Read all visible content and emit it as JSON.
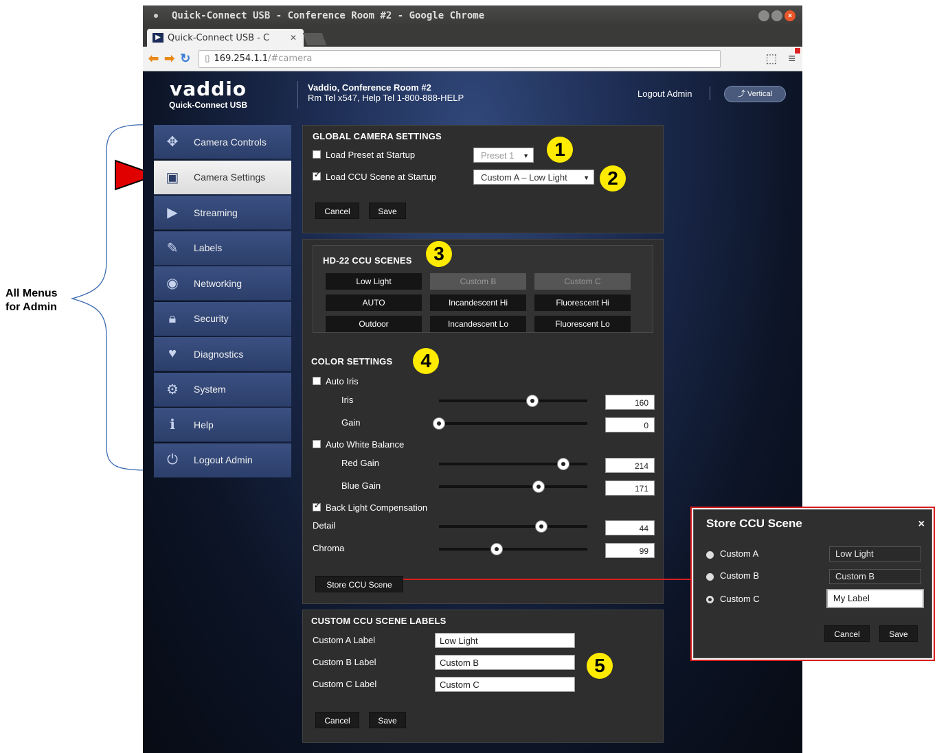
{
  "annotation": {
    "all_menus_line1": "All Menus",
    "all_menus_line2": "for Admin"
  },
  "browser": {
    "window_title": "Quick-Connect USB - Conference Room #2 - Google Chrome",
    "tab_title": "Quick-Connect USB - C",
    "url_host": "169.254.1.1",
    "url_path": "/#camera"
  },
  "header": {
    "brand": "vaddio",
    "product": "Quick-Connect USB",
    "room_title": "Vaddio, Conference Room #2",
    "room_info": "Rm Tel x547, Help Tel 1-800-888-HELP",
    "logout": "Logout Admin",
    "vertical": "Vertical"
  },
  "sidebar": {
    "items": [
      {
        "label": "Camera Controls",
        "icon": "camera-controls-icon",
        "active": false
      },
      {
        "label": "Camera Settings",
        "icon": "camera-settings-icon",
        "active": true
      },
      {
        "label": "Streaming",
        "icon": "streaming-icon",
        "active": false
      },
      {
        "label": "Labels",
        "icon": "labels-icon",
        "active": false
      },
      {
        "label": "Networking",
        "icon": "networking-icon",
        "active": false
      },
      {
        "label": "Security",
        "icon": "security-icon",
        "active": false
      },
      {
        "label": "Diagnostics",
        "icon": "diagnostics-icon",
        "active": false
      },
      {
        "label": "System",
        "icon": "system-icon",
        "active": false
      },
      {
        "label": "Help",
        "icon": "help-icon",
        "active": false
      },
      {
        "label": "Logout Admin",
        "icon": "power-icon",
        "active": false
      }
    ]
  },
  "global": {
    "title": "GLOBAL CAMERA SETTINGS",
    "load_preset_label": "Load Preset at Startup",
    "load_preset_checked": false,
    "preset_value": "Preset 1",
    "load_ccu_label": "Load CCU Scene at Startup",
    "load_ccu_checked": true,
    "ccu_value": "Custom A – Low Light",
    "cancel": "Cancel",
    "save": "Save"
  },
  "scenes": {
    "title": "HD-22 CCU SCENES",
    "buttons": [
      [
        "Low Light",
        "Custom B",
        "Custom C"
      ],
      [
        "AUTO",
        "Incandescent Hi",
        "Fluorescent Hi"
      ],
      [
        "Outdoor",
        "Incandescent Lo",
        "Fluorescent Lo"
      ]
    ]
  },
  "color": {
    "title": "COLOR SETTINGS",
    "auto_iris_label": "Auto Iris",
    "auto_iris_checked": false,
    "iris_label": "Iris",
    "iris_value": "160",
    "gain_label": "Gain",
    "gain_value": "0",
    "awb_label": "Auto White Balance",
    "awb_checked": false,
    "red_gain_label": "Red Gain",
    "red_gain_value": "214",
    "blue_gain_label": "Blue Gain",
    "blue_gain_value": "171",
    "blc_label": "Back Light Compensation",
    "blc_checked": true,
    "detail_label": "Detail",
    "detail_value": "44",
    "chroma_label": "Chroma",
    "chroma_value": "99",
    "store_button": "Store CCU Scene",
    "slider_levels": {
      "iris": 0.63,
      "gain": 0.0,
      "red_gain": 0.84,
      "blue_gain": 0.67,
      "detail": 0.69,
      "chroma": 0.39
    }
  },
  "labels_panel": {
    "title": "CUSTOM CCU SCENE LABELS",
    "a_label": "Custom A Label",
    "a_value": "Low Light",
    "b_label": "Custom B Label",
    "b_value": "Custom B",
    "c_label": "Custom C Label",
    "c_value": "Custom C",
    "cancel": "Cancel",
    "save": "Save"
  },
  "callouts": [
    "1",
    "2",
    "3",
    "4",
    "5"
  ],
  "dialog": {
    "title": "Store CCU Scene",
    "close": "×",
    "options": [
      {
        "label": "Custom A",
        "value": "Low Light",
        "selected": false
      },
      {
        "label": "Custom B",
        "value": "Custom B",
        "selected": false
      },
      {
        "label": "Custom C",
        "value": "My Label",
        "selected": true
      }
    ],
    "cancel": "Cancel",
    "save": "Save"
  },
  "colors": {
    "callout_yellow": "#ffeb00",
    "highlight_red": "#d81e1e",
    "nav_blue": "#3b5082"
  }
}
